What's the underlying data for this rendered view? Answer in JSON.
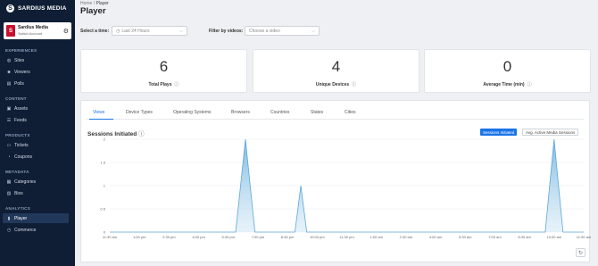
{
  "brand": {
    "name": "SARDIUS MEDIA",
    "mark": "S"
  },
  "account": {
    "name": "Sardius Media",
    "sub": "Switch Account",
    "logo_letter": "S"
  },
  "sidebar": {
    "sections": [
      {
        "title": "EXPERIENCES",
        "items": [
          {
            "label": "Sites",
            "icon": "globe-icon"
          },
          {
            "label": "Viewers",
            "icon": "users-icon"
          },
          {
            "label": "Polls",
            "icon": "poll-icon"
          }
        ]
      },
      {
        "title": "CONTENT",
        "items": [
          {
            "label": "Assets",
            "icon": "asset-icon"
          },
          {
            "label": "Feeds",
            "icon": "feed-icon"
          }
        ]
      },
      {
        "title": "PRODUCTS",
        "items": [
          {
            "label": "Tickets",
            "icon": "ticket-icon"
          },
          {
            "label": "Coupons",
            "icon": "coupon-icon"
          }
        ]
      },
      {
        "title": "METADATA",
        "items": [
          {
            "label": "Categories",
            "icon": "category-icon"
          },
          {
            "label": "Bios",
            "icon": "bio-icon"
          }
        ]
      },
      {
        "title": "ANALYTICS",
        "items": [
          {
            "label": "Player",
            "icon": "player-icon"
          },
          {
            "label": "Commerce",
            "icon": "commerce-icon"
          }
        ]
      }
    ],
    "active": "Player"
  },
  "header": {
    "breadcrumb_home": "Home",
    "breadcrumb_sep": "/",
    "breadcrumb_current": "Player",
    "title": "Player"
  },
  "filters": {
    "time_label": "Select a time:",
    "time_value": "Last 24 Hours",
    "videos_label": "Filter by videos:",
    "videos_placeholder": "Choose a video"
  },
  "stats": [
    {
      "value": "6",
      "label": "Total Plays"
    },
    {
      "value": "4",
      "label": "Unique Devices"
    },
    {
      "value": "0",
      "label": "Average Time (min)"
    }
  ],
  "tabs": [
    "Views",
    "Device Types",
    "Operating Systems",
    "Browsers",
    "Countries",
    "States",
    "Cities"
  ],
  "active_tab": "Views",
  "chart_header": {
    "title": "Sessions Initiated",
    "toggle_on": "Sessions Initiated",
    "toggle_off": "Avg. Active Media Sessions"
  },
  "chart_data": {
    "type": "area",
    "title": "Sessions Initiated",
    "x": [
      "11:30 am",
      "1:00 pm",
      "2:30 pm",
      "4:00 pm",
      "5:30 pm",
      "7:00 pm",
      "8:30 pm",
      "10:00 pm",
      "11:30 pm",
      "1:00 am",
      "2:30 am",
      "4:00 am",
      "5:30 am",
      "7:00 am",
      "8:30 am",
      "10:00 am",
      "11:30 am"
    ],
    "yticks": [
      "0",
      "0.5",
      "1",
      "1.5",
      "2"
    ],
    "ylim": [
      0,
      2
    ],
    "points": [
      [
        0,
        0
      ],
      [
        4.25,
        0
      ],
      [
        4.58,
        2
      ],
      [
        4.9,
        0
      ],
      [
        6.25,
        0
      ],
      [
        6.45,
        1
      ],
      [
        6.65,
        0
      ],
      [
        14.7,
        0
      ],
      [
        15.0,
        2
      ],
      [
        15.3,
        0
      ],
      [
        16,
        0
      ]
    ],
    "color": "#9ecbe6"
  },
  "colors": {
    "accent": "#1a73e8",
    "sidebar": "#0f1e35"
  }
}
